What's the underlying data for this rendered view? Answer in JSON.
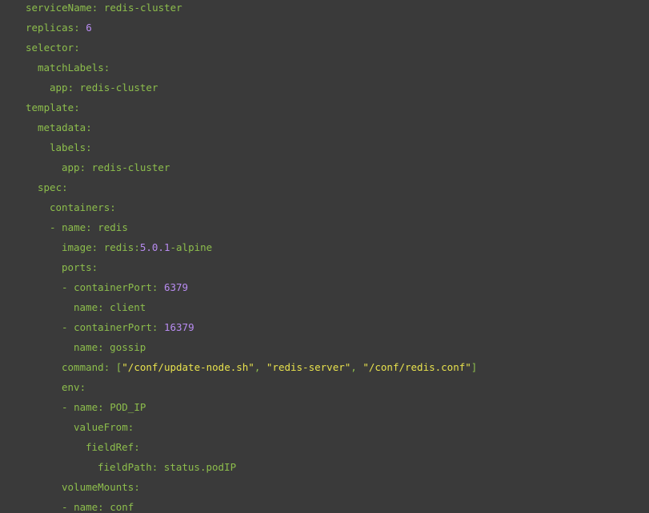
{
  "editor": {
    "lines": [
      {
        "indent": 4,
        "tokens": [
          {
            "t": "key",
            "v": "serviceName"
          },
          {
            "t": "punc",
            "v": ": "
          },
          {
            "t": "val",
            "v": "redis-cluster"
          }
        ]
      },
      {
        "indent": 4,
        "tokens": [
          {
            "t": "key",
            "v": "replicas"
          },
          {
            "t": "punc",
            "v": ": "
          },
          {
            "t": "num",
            "v": "6"
          }
        ]
      },
      {
        "indent": 4,
        "tokens": [
          {
            "t": "key",
            "v": "selector"
          },
          {
            "t": "punc",
            "v": ":"
          }
        ]
      },
      {
        "indent": 6,
        "tokens": [
          {
            "t": "key",
            "v": "matchLabels"
          },
          {
            "t": "punc",
            "v": ":"
          }
        ]
      },
      {
        "indent": 8,
        "tokens": [
          {
            "t": "key",
            "v": "app"
          },
          {
            "t": "punc",
            "v": ": "
          },
          {
            "t": "val",
            "v": "redis-cluster"
          }
        ]
      },
      {
        "indent": 4,
        "tokens": [
          {
            "t": "key",
            "v": "template"
          },
          {
            "t": "punc",
            "v": ":"
          }
        ]
      },
      {
        "indent": 6,
        "tokens": [
          {
            "t": "key",
            "v": "metadata"
          },
          {
            "t": "punc",
            "v": ":"
          }
        ]
      },
      {
        "indent": 8,
        "tokens": [
          {
            "t": "key",
            "v": "labels"
          },
          {
            "t": "punc",
            "v": ":"
          }
        ]
      },
      {
        "indent": 10,
        "tokens": [
          {
            "t": "key",
            "v": "app"
          },
          {
            "t": "punc",
            "v": ": "
          },
          {
            "t": "val",
            "v": "redis-cluster"
          }
        ]
      },
      {
        "indent": 6,
        "tokens": [
          {
            "t": "key",
            "v": "spec"
          },
          {
            "t": "punc",
            "v": ":"
          }
        ]
      },
      {
        "indent": 8,
        "tokens": [
          {
            "t": "key",
            "v": "containers"
          },
          {
            "t": "punc",
            "v": ":"
          }
        ]
      },
      {
        "indent": 8,
        "tokens": [
          {
            "t": "punc",
            "v": "- "
          },
          {
            "t": "key",
            "v": "name"
          },
          {
            "t": "punc",
            "v": ": "
          },
          {
            "t": "val",
            "v": "redis"
          }
        ]
      },
      {
        "indent": 10,
        "tokens": [
          {
            "t": "key",
            "v": "image"
          },
          {
            "t": "punc",
            "v": ": "
          },
          {
            "t": "val",
            "v": "redis:"
          },
          {
            "t": "num",
            "v": "5.0.1"
          },
          {
            "t": "val",
            "v": "-alpine"
          }
        ]
      },
      {
        "indent": 10,
        "tokens": [
          {
            "t": "key",
            "v": "ports"
          },
          {
            "t": "punc",
            "v": ":"
          }
        ]
      },
      {
        "indent": 10,
        "tokens": [
          {
            "t": "punc",
            "v": "- "
          },
          {
            "t": "key",
            "v": "containerPort"
          },
          {
            "t": "punc",
            "v": ": "
          },
          {
            "t": "num",
            "v": "6379"
          }
        ]
      },
      {
        "indent": 12,
        "tokens": [
          {
            "t": "key",
            "v": "name"
          },
          {
            "t": "punc",
            "v": ": "
          },
          {
            "t": "val",
            "v": "client"
          }
        ]
      },
      {
        "indent": 10,
        "tokens": [
          {
            "t": "punc",
            "v": "- "
          },
          {
            "t": "key",
            "v": "containerPort"
          },
          {
            "t": "punc",
            "v": ": "
          },
          {
            "t": "num",
            "v": "16379"
          }
        ]
      },
      {
        "indent": 12,
        "tokens": [
          {
            "t": "key",
            "v": "name"
          },
          {
            "t": "punc",
            "v": ": "
          },
          {
            "t": "val",
            "v": "gossip"
          }
        ]
      },
      {
        "indent": 10,
        "tokens": [
          {
            "t": "key",
            "v": "command"
          },
          {
            "t": "punc",
            "v": ": ["
          },
          {
            "t": "str",
            "v": "\"/conf/update-node.sh\""
          },
          {
            "t": "punc",
            "v": ", "
          },
          {
            "t": "str",
            "v": "\"redis-server\""
          },
          {
            "t": "punc",
            "v": ", "
          },
          {
            "t": "str",
            "v": "\"/conf/redis.conf\""
          },
          {
            "t": "punc",
            "v": "]"
          }
        ]
      },
      {
        "indent": 10,
        "tokens": [
          {
            "t": "key",
            "v": "env"
          },
          {
            "t": "punc",
            "v": ":"
          }
        ]
      },
      {
        "indent": 10,
        "tokens": [
          {
            "t": "punc",
            "v": "- "
          },
          {
            "t": "key",
            "v": "name"
          },
          {
            "t": "punc",
            "v": ": "
          },
          {
            "t": "val",
            "v": "POD_IP"
          }
        ]
      },
      {
        "indent": 12,
        "tokens": [
          {
            "t": "key",
            "v": "valueFrom"
          },
          {
            "t": "punc",
            "v": ":"
          }
        ]
      },
      {
        "indent": 14,
        "tokens": [
          {
            "t": "key",
            "v": "fieldRef"
          },
          {
            "t": "punc",
            "v": ":"
          }
        ]
      },
      {
        "indent": 16,
        "tokens": [
          {
            "t": "key",
            "v": "fieldPath"
          },
          {
            "t": "punc",
            "v": ": "
          },
          {
            "t": "val",
            "v": "status.podIP"
          }
        ]
      },
      {
        "indent": 10,
        "tokens": [
          {
            "t": "key",
            "v": "volumeMounts"
          },
          {
            "t": "punc",
            "v": ":"
          }
        ]
      },
      {
        "indent": 10,
        "tokens": [
          {
            "t": "punc",
            "v": "- "
          },
          {
            "t": "key",
            "v": "name"
          },
          {
            "t": "punc",
            "v": ": "
          },
          {
            "t": "val",
            "v": "conf"
          }
        ]
      }
    ]
  },
  "colors": {
    "background": "#3a3a3a",
    "key": "#8dbe4c",
    "number": "#b98cf2",
    "string": "#e8e24d"
  }
}
